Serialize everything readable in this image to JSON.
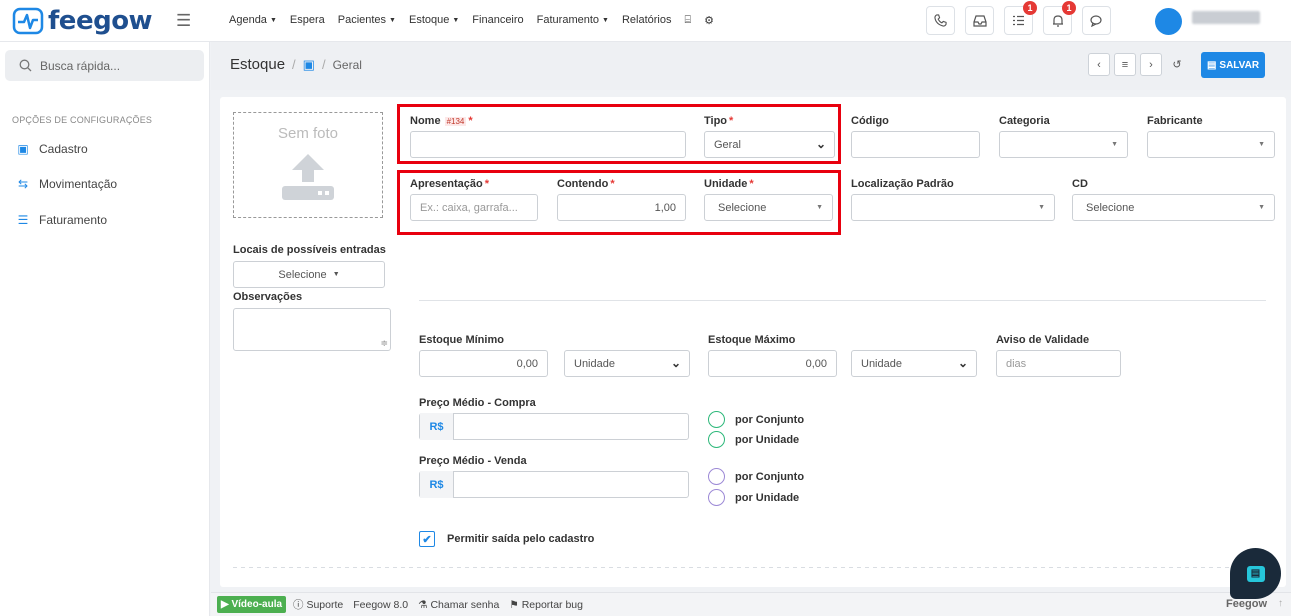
{
  "app": {
    "name": "feegow",
    "user_name": "IVOLS ISBN"
  },
  "nav": [
    "Agenda",
    "Espera",
    "Pacientes",
    "Estoque",
    "Financeiro",
    "Faturamento",
    "Relatórios"
  ],
  "nav_dropdowns": [
    true,
    false,
    true,
    true,
    false,
    true,
    false
  ],
  "notifications": {
    "tasks_count": "1",
    "bell_count": "1"
  },
  "sidebar": {
    "search_placeholder": "Busca rápida...",
    "section_title": "OPÇÕES DE CONFIGURAÇÕES",
    "items": [
      {
        "label": "Cadastro",
        "icon": "box-icon"
      },
      {
        "label": "Movimentação",
        "icon": "arrows-icon"
      },
      {
        "label": "Faturamento",
        "icon": "list-icon"
      }
    ]
  },
  "breadcrumb": {
    "root": "Estoque",
    "current": "Geral"
  },
  "header": {
    "save_label": "SALVAR"
  },
  "photo": {
    "label": "Sem foto"
  },
  "form": {
    "nome_label": "Nome",
    "nome_id": "#134",
    "tipo_label": "Tipo",
    "tipo_value": "Geral",
    "codigo_label": "Código",
    "categoria_label": "Categoria",
    "fabricante_label": "Fabricante",
    "apresentacao_label": "Apresentação",
    "apresentacao_placeholder": "Ex.: caixa, garrafa...",
    "contendo_label": "Contendo",
    "contendo_value": "1,00",
    "unidade_label": "Unidade",
    "unidade_value": "Selecione",
    "localizacao_label": "Localização Padrão",
    "cd_label": "CD",
    "cd_value": "Selecione",
    "locais_label": "Locais de possíveis entradas",
    "locais_value": "Selecione",
    "observacoes_label": "Observações",
    "estoque_min_label": "Estoque Mínimo",
    "estoque_min_value": "0,00",
    "estoque_min_unit": "Unidade",
    "estoque_max_label": "Estoque Máximo",
    "estoque_max_value": "0,00",
    "estoque_max_unit": "Unidade",
    "aviso_label": "Aviso de Validade",
    "aviso_placeholder": "dias",
    "preco_compra_label": "Preço Médio - Compra",
    "preco_venda_label": "Preço Médio - Venda",
    "currency": "R$",
    "compra_options": [
      "por Conjunto",
      "por Unidade"
    ],
    "venda_options": [
      "por Conjunto",
      "por Unidade"
    ],
    "permitir_label": "Permitir saída pelo cadastro",
    "permitir_checked": true
  },
  "footer": {
    "video": "Vídeo-aula",
    "suporte": "Suporte",
    "version": "Feegow 8.0",
    "chamar": "Chamar senha",
    "reportar": "Reportar bug",
    "brand": "Feegow"
  },
  "colors": {
    "accent": "#1e88e5",
    "highlight": "#e8000e",
    "green": "#4caf50"
  }
}
